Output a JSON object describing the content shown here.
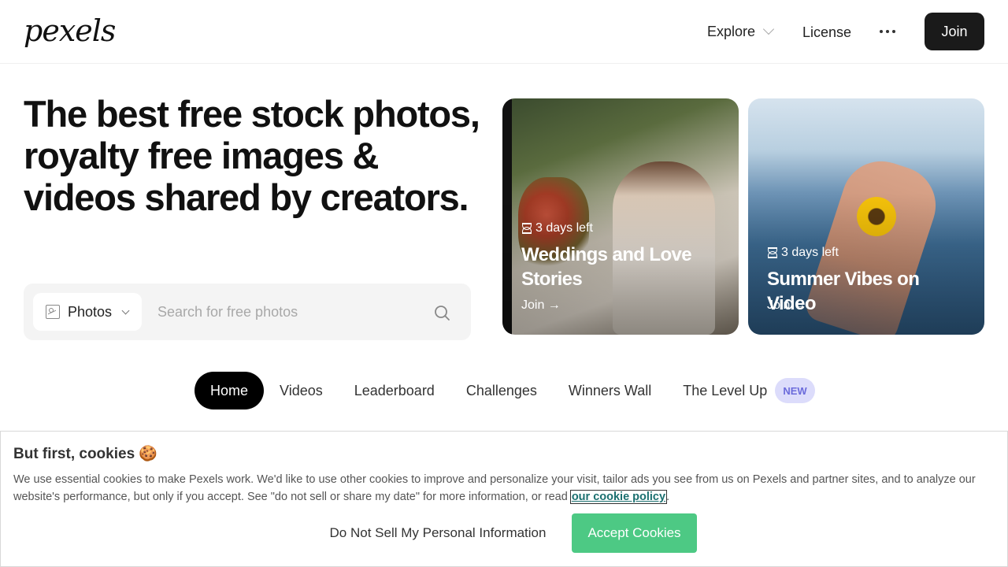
{
  "header": {
    "logo": "pexels",
    "nav": {
      "explore": "Explore",
      "license": "License"
    },
    "join_label": "Join"
  },
  "hero": {
    "title": "The best free stock photos, royalty free images & videos shared by creators.",
    "search": {
      "type_label": "Photos",
      "placeholder": "Search for free photos"
    }
  },
  "promos": [
    {
      "time_left": "3 days left",
      "title": "Weddings and Love Stories",
      "cta": "Join →"
    },
    {
      "time_left": "3 days left",
      "title": "Summer Vibes on Video",
      "cta": "Join →"
    }
  ],
  "tabs": [
    {
      "label": "Home",
      "active": true
    },
    {
      "label": "Videos"
    },
    {
      "label": "Leaderboard"
    },
    {
      "label": "Challenges"
    },
    {
      "label": "Winners Wall"
    },
    {
      "label": "The Level Up",
      "badge": "NEW"
    }
  ],
  "cookie_banner": {
    "title": "But first, cookies 🍪",
    "text": "We use essential cookies to make Pexels work. We'd like to use other cookies to improve and personalize your visit, tailor ads you see from us on Pexels and partner sites, and to analyze our website's performance, but only if you accept. See \"do not sell or share my date\" for more information, or read",
    "link": "our cookie policy",
    "after_link": ".",
    "do_not_sell_label": "Do Not Sell My Personal Information",
    "accept_label": "Accept Cookies"
  },
  "colors": {
    "accept_green": "#4dc984",
    "badge_bg": "#dcdcfb",
    "badge_text": "#6b6bdb"
  }
}
